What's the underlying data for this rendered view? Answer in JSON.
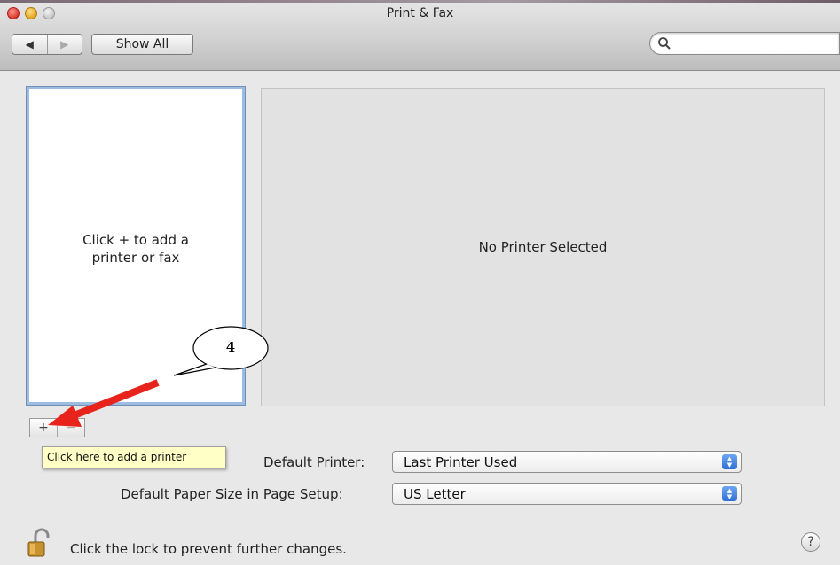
{
  "window": {
    "title": "Print & Fax"
  },
  "toolbar": {
    "back_glyph": "◀",
    "forward_glyph": "▶",
    "show_all_label": "Show All",
    "search_placeholder": ""
  },
  "printer_list": {
    "empty_hint": "Click + to add a printer or fax"
  },
  "detail": {
    "message": "No Printer Selected"
  },
  "list_buttons": {
    "add": "+",
    "remove": "−"
  },
  "tooltip": {
    "text": "Click here to add a printer"
  },
  "settings": {
    "default_printer_label": "Default Printer:",
    "default_printer_value": "Last Printer Used",
    "paper_size_label": "Default Paper Size in Page Setup:",
    "paper_size_value": "US Letter"
  },
  "footer": {
    "lock_text": "Click the lock to prevent further changes.",
    "help_glyph": "?"
  },
  "annotation": {
    "step_number": "4",
    "arrow_color": "#e8231c"
  },
  "icons": [
    "search-icon",
    "lock-icon",
    "help-icon",
    "up-down-arrows-icon"
  ]
}
